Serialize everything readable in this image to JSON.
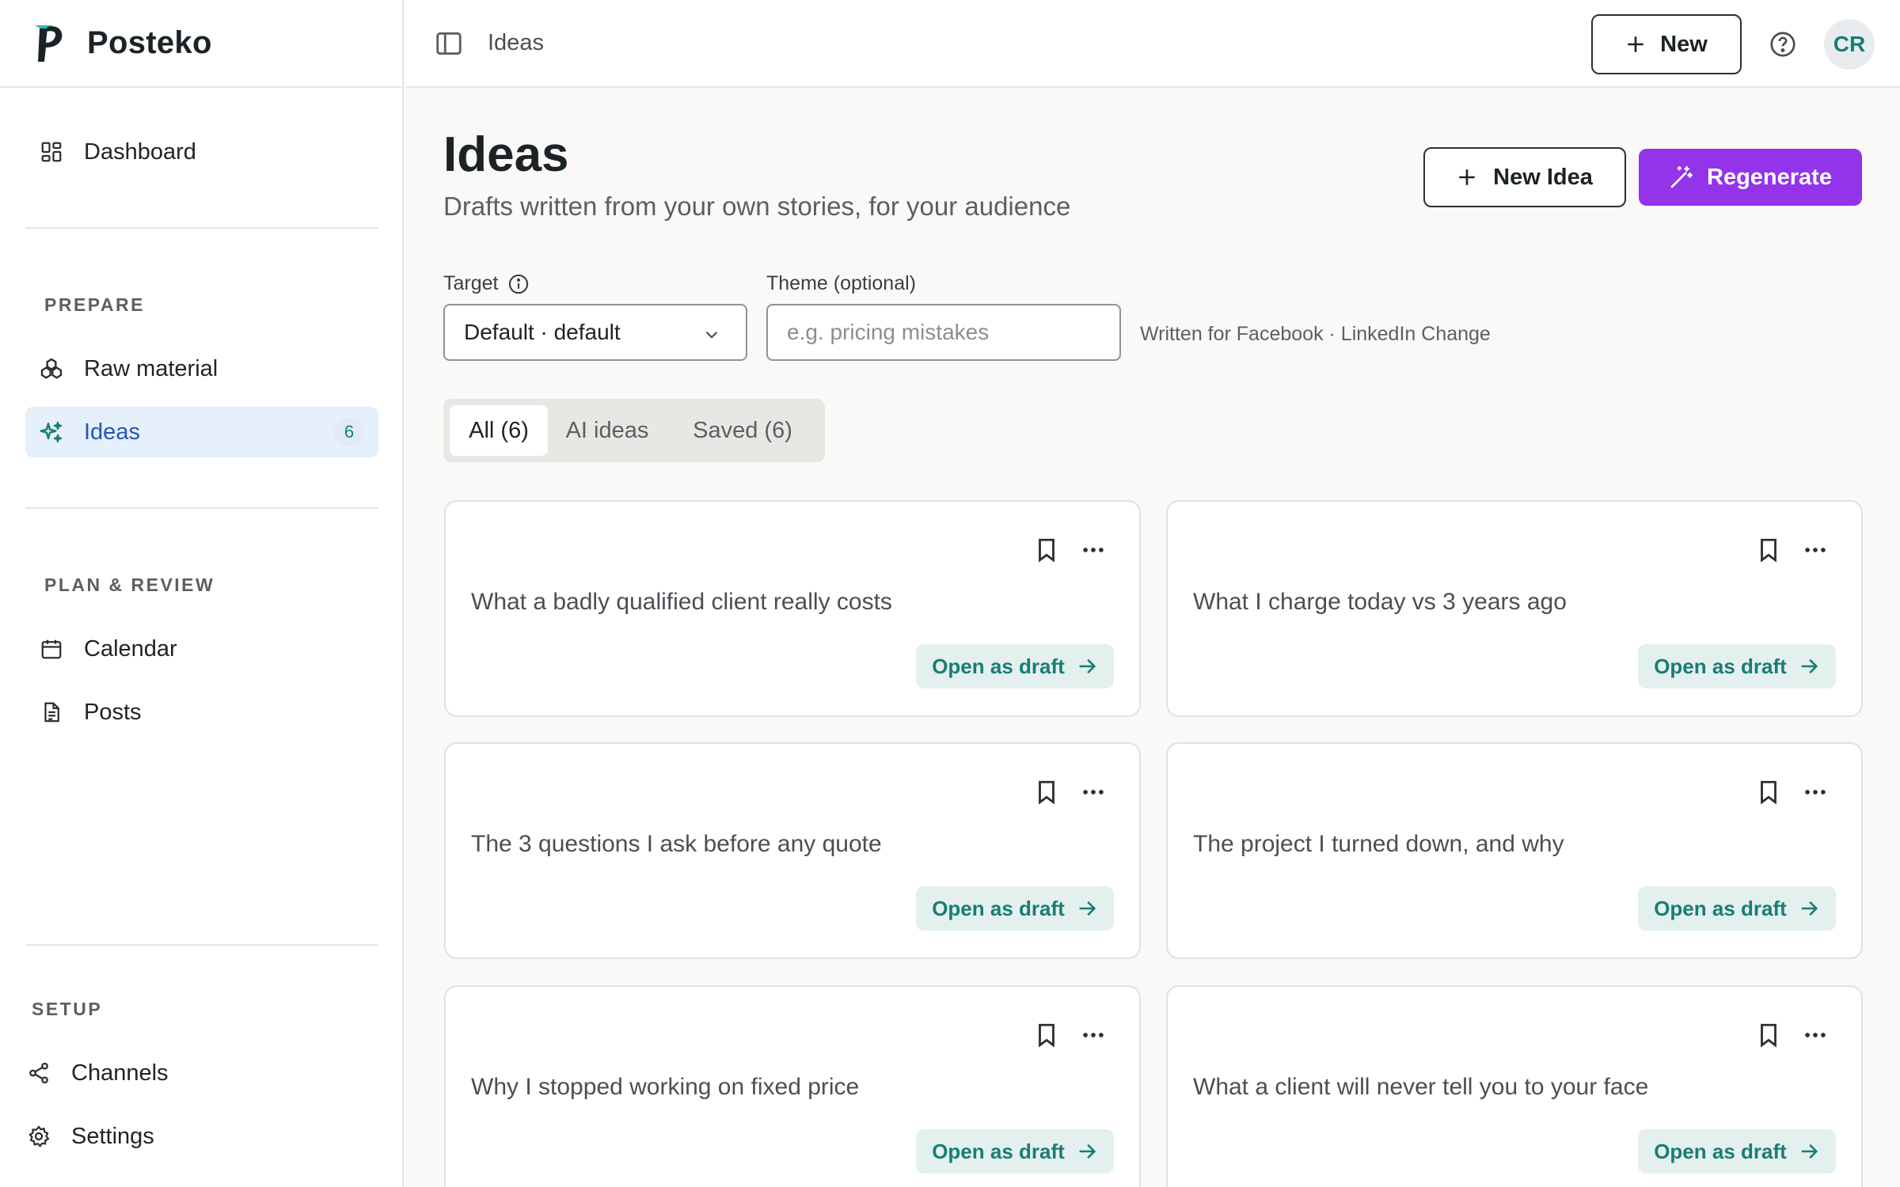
{
  "app": {
    "name": "Posteko"
  },
  "sidebar": {
    "dashboard": "Dashboard",
    "sections": {
      "prepare": "PREPARE",
      "plan_review": "PLAN & REVIEW",
      "setup": "SETUP"
    },
    "items": {
      "raw_material": "Raw material",
      "ideas": "Ideas",
      "ideas_count": "6",
      "calendar": "Calendar",
      "posts": "Posts",
      "channels": "Channels",
      "settings": "Settings"
    }
  },
  "topbar": {
    "breadcrumb": "Ideas",
    "new_label": "New",
    "avatar_initials": "CR"
  },
  "page": {
    "title": "Ideas",
    "subtitle": "Drafts written from your own stories, for your audience",
    "new_idea_label": "New Idea",
    "regenerate_label": "Regenerate"
  },
  "filters": {
    "target_label": "Target",
    "target_value": "Default · default",
    "theme_label": "Theme (optional)",
    "theme_placeholder": "e.g. pricing mistakes",
    "written_for": "Written for Facebook · LinkedIn Change"
  },
  "tabs": {
    "all": "All (6)",
    "ai": "AI ideas",
    "saved": "Saved (6)"
  },
  "cards": [
    {
      "title": "What a badly qualified client really costs",
      "action": "Open as draft"
    },
    {
      "title": "What I charge today vs 3 years ago",
      "action": "Open as draft"
    },
    {
      "title": "The 3 questions I ask before any quote",
      "action": "Open as draft"
    },
    {
      "title": "The project I turned down, and why",
      "action": "Open as draft"
    },
    {
      "title": "Why I stopped working on fixed price",
      "action": "Open as draft"
    },
    {
      "title": "What a client will never tell you to your face",
      "action": "Open as draft"
    }
  ],
  "colors": {
    "accent_purple": "#9333ea",
    "accent_teal": "#177e74",
    "active_bg": "#e6f0fa",
    "active_text": "#2157b8"
  }
}
